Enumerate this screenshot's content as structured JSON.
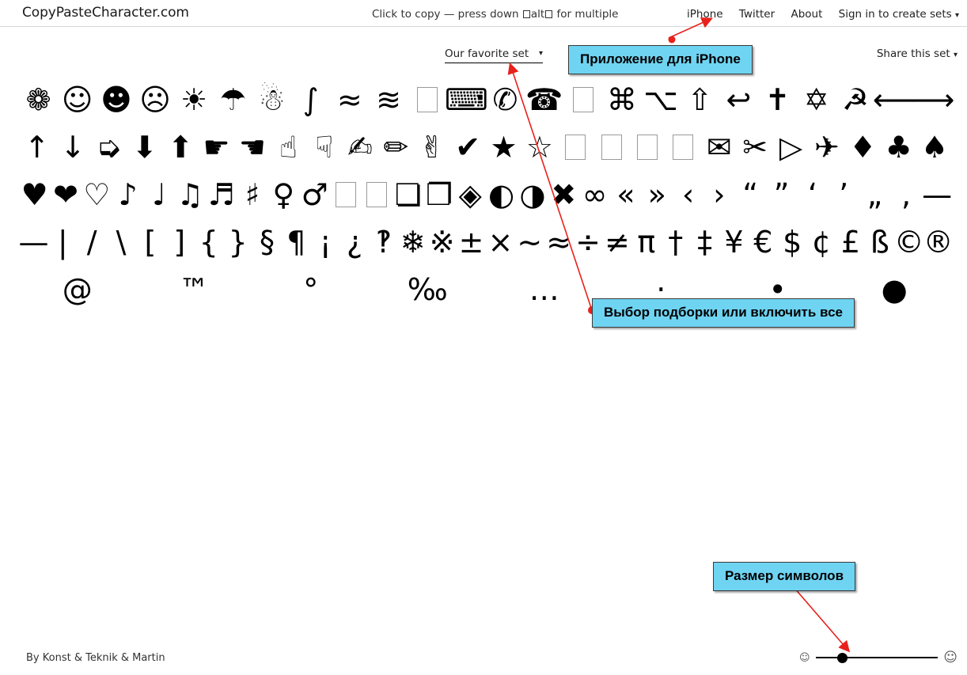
{
  "header": {
    "site_title": "CopyPasteCharacter.com",
    "hint_before": "Click to copy — press down ",
    "hint_key": "alt",
    "hint_after": " for multiple",
    "nav": [
      {
        "label": "iPhone"
      },
      {
        "label": "Twitter"
      },
      {
        "label": "About"
      },
      {
        "label": "Sign in to create sets",
        "caret": "▾"
      }
    ]
  },
  "subbar": {
    "set_select_label": "Our favorite set",
    "set_select_caret": "▾",
    "share_label": "Share this set",
    "share_caret": "▾"
  },
  "callouts": [
    {
      "id": "iphone",
      "text": "Приложение для iPhone",
      "color": "#6fd4f2"
    },
    {
      "id": "set",
      "text": "Выбор подборки или включить все",
      "color": "#6fd4f2"
    },
    {
      "id": "size",
      "text": "Размер символов",
      "color": "#6fd4f2"
    }
  ],
  "annotation_color": "#e8211c",
  "grid": {
    "rows": [
      [
        {
          "glyph": "❁",
          "name": "flower"
        },
        {
          "glyph": "☺",
          "name": "white-smiling-face"
        },
        {
          "glyph": "☻",
          "name": "black-smiling-face"
        },
        {
          "glyph": "☹",
          "name": "frowning-face"
        },
        {
          "glyph": "☀",
          "name": "sun"
        },
        {
          "glyph": "☂",
          "name": "umbrella"
        },
        {
          "glyph": "☃",
          "name": "snowman"
        },
        {
          "glyph": "∫",
          "name": "integral-wave"
        },
        {
          "glyph": "≈",
          "name": "almost-equal-wave"
        },
        {
          "glyph": "≋",
          "name": "triple-tilde"
        },
        {
          "glyph": "□",
          "name": "missing-glyph-box",
          "box": true
        },
        {
          "glyph": "⌨",
          "name": "keyboard"
        },
        {
          "glyph": "✆",
          "name": "telephone-location"
        },
        {
          "glyph": "☎",
          "name": "black-telephone"
        },
        {
          "glyph": "□",
          "name": "missing-glyph-box",
          "box": true
        },
        {
          "glyph": "⌘",
          "name": "command-key"
        },
        {
          "glyph": "⌥",
          "name": "option-key"
        },
        {
          "glyph": "⇧",
          "name": "shift-key"
        },
        {
          "glyph": "↩",
          "name": "return-arrow"
        },
        {
          "glyph": "✝",
          "name": "latin-cross"
        },
        {
          "glyph": "✡",
          "name": "star-of-david"
        },
        {
          "glyph": "☭",
          "name": "hammer-and-sickle"
        },
        {
          "glyph": "⟵",
          "name": "long-left-arrow"
        },
        {
          "glyph": "⟶",
          "name": "long-right-arrow"
        }
      ],
      [
        {
          "glyph": "↑",
          "name": "up-arrow"
        },
        {
          "glyph": "↓",
          "name": "down-arrow"
        },
        {
          "glyph": "➭",
          "name": "shadowed-right-arrow"
        },
        {
          "glyph": "⬇",
          "name": "heavy-down-arrow"
        },
        {
          "glyph": "⬆",
          "name": "heavy-up-arrow"
        },
        {
          "glyph": "☛",
          "name": "pointing-right-hand"
        },
        {
          "glyph": "☚",
          "name": "pointing-left-hand"
        },
        {
          "glyph": "☝",
          "name": "pointing-up-hand"
        },
        {
          "glyph": "☟",
          "name": "pointing-down-hand"
        },
        {
          "glyph": "✍",
          "name": "writing-hand"
        },
        {
          "glyph": "✏",
          "name": "pencil"
        },
        {
          "glyph": "✌",
          "name": "victory-hand"
        },
        {
          "glyph": "✔",
          "name": "check-mark"
        },
        {
          "glyph": "★",
          "name": "black-star"
        },
        {
          "glyph": "☆",
          "name": "white-star"
        },
        {
          "glyph": "□",
          "name": "missing-glyph-box",
          "box": true
        },
        {
          "glyph": "□",
          "name": "missing-glyph-box",
          "box": true
        },
        {
          "glyph": "□",
          "name": "missing-glyph-box",
          "box": true
        },
        {
          "glyph": "□",
          "name": "missing-glyph-box",
          "box": true
        },
        {
          "glyph": "✉",
          "name": "envelope"
        },
        {
          "glyph": "✂",
          "name": "scissors"
        },
        {
          "glyph": "▷",
          "name": "white-right-triangle"
        },
        {
          "glyph": "✈",
          "name": "airplane"
        },
        {
          "glyph": "♦",
          "name": "black-diamond-suit"
        },
        {
          "glyph": "♣",
          "name": "black-club-suit"
        },
        {
          "glyph": "♠",
          "name": "black-spade-suit"
        }
      ],
      [
        {
          "glyph": "♥",
          "name": "black-heart-suit"
        },
        {
          "glyph": "❤",
          "name": "heavy-black-heart"
        },
        {
          "glyph": "♡",
          "name": "white-heart-suit"
        },
        {
          "glyph": "♪",
          "name": "eighth-note"
        },
        {
          "glyph": "♩",
          "name": "quarter-note"
        },
        {
          "glyph": "♫",
          "name": "beamed-eighth-notes"
        },
        {
          "glyph": "♬",
          "name": "beamed-sixteenth-notes"
        },
        {
          "glyph": "♯",
          "name": "music-sharp-sign"
        },
        {
          "glyph": "♀",
          "name": "female-sign"
        },
        {
          "glyph": "♂",
          "name": "male-sign"
        },
        {
          "glyph": "□",
          "name": "missing-glyph-box",
          "box": true
        },
        {
          "glyph": "□",
          "name": "missing-glyph-box",
          "box": true
        },
        {
          "glyph": "❏",
          "name": "lower-right-shadowed-square"
        },
        {
          "glyph": "❐",
          "name": "upper-right-shadowed-square"
        },
        {
          "glyph": "◈",
          "name": "white-diamond-black-center"
        },
        {
          "glyph": "◐",
          "name": "circle-left-half-black"
        },
        {
          "glyph": "◑",
          "name": "circle-right-half-black"
        },
        {
          "glyph": "✖",
          "name": "heavy-multiplication-x"
        },
        {
          "glyph": "∞",
          "name": "infinity"
        },
        {
          "glyph": "«",
          "name": "left-guillemet"
        },
        {
          "glyph": "»",
          "name": "right-guillemet"
        },
        {
          "glyph": "‹",
          "name": "single-left-guillemet"
        },
        {
          "glyph": "›",
          "name": "single-right-guillemet"
        },
        {
          "glyph": "“",
          "name": "left-double-quote"
        },
        {
          "glyph": "”",
          "name": "right-double-quote"
        },
        {
          "glyph": "‘",
          "name": "left-single-quote"
        },
        {
          "glyph": "’",
          "name": "right-single-quote"
        },
        {
          "glyph": "„",
          "name": "double-low-quote"
        },
        {
          "glyph": "‚",
          "name": "single-low-quote"
        },
        {
          "glyph": "—",
          "name": "em-dash"
        }
      ],
      [
        {
          "glyph": "—",
          "name": "em-dash"
        },
        {
          "glyph": "|",
          "name": "vertical-bar"
        },
        {
          "glyph": "/",
          "name": "solidus"
        },
        {
          "glyph": "\\",
          "name": "reverse-solidus"
        },
        {
          "glyph": "[",
          "name": "left-square-bracket"
        },
        {
          "glyph": "]",
          "name": "right-square-bracket"
        },
        {
          "glyph": "{",
          "name": "left-curly-brace"
        },
        {
          "glyph": "}",
          "name": "right-curly-brace"
        },
        {
          "glyph": "§",
          "name": "section-sign"
        },
        {
          "glyph": "¶",
          "name": "pilcrow"
        },
        {
          "glyph": "¡",
          "name": "inverted-exclamation"
        },
        {
          "glyph": "¿",
          "name": "inverted-question"
        },
        {
          "glyph": "‽",
          "name": "interrobang"
        },
        {
          "glyph": "❄",
          "name": "snowflake"
        },
        {
          "glyph": "※",
          "name": "reference-mark"
        },
        {
          "glyph": "±",
          "name": "plus-minus"
        },
        {
          "glyph": "×",
          "name": "multiplication-sign"
        },
        {
          "glyph": "~",
          "name": "tilde"
        },
        {
          "glyph": "≈",
          "name": "almost-equal-to"
        },
        {
          "glyph": "÷",
          "name": "division-sign"
        },
        {
          "glyph": "≠",
          "name": "not-equal-to"
        },
        {
          "glyph": "π",
          "name": "pi"
        },
        {
          "glyph": "†",
          "name": "dagger"
        },
        {
          "glyph": "‡",
          "name": "double-dagger"
        },
        {
          "glyph": "¥",
          "name": "yen-sign"
        },
        {
          "glyph": "€",
          "name": "euro-sign"
        },
        {
          "glyph": "$",
          "name": "dollar-sign"
        },
        {
          "glyph": "¢",
          "name": "cent-sign"
        },
        {
          "glyph": "£",
          "name": "pound-sign"
        },
        {
          "glyph": "ß",
          "name": "sharp-s"
        },
        {
          "glyph": "©",
          "name": "copyright-sign"
        },
        {
          "glyph": "®",
          "name": "registered-sign"
        }
      ],
      [
        {
          "glyph": "@",
          "name": "at-sign"
        },
        {
          "glyph": "™",
          "name": "trademark-sign"
        },
        {
          "glyph": "°",
          "name": "degree-sign"
        },
        {
          "glyph": "‰",
          "name": "per-mille-sign"
        },
        {
          "glyph": "…",
          "name": "horizontal-ellipsis"
        },
        {
          "glyph": "·",
          "name": "middle-dot"
        },
        {
          "glyph": "•",
          "name": "bullet"
        },
        {
          "glyph": "●",
          "name": "black-circle"
        }
      ]
    ]
  },
  "footer": {
    "credit": "By Konst & Teknik & Martin",
    "slider": {
      "small_face": "☺",
      "big_face": "☺",
      "value_percent": 22
    }
  }
}
